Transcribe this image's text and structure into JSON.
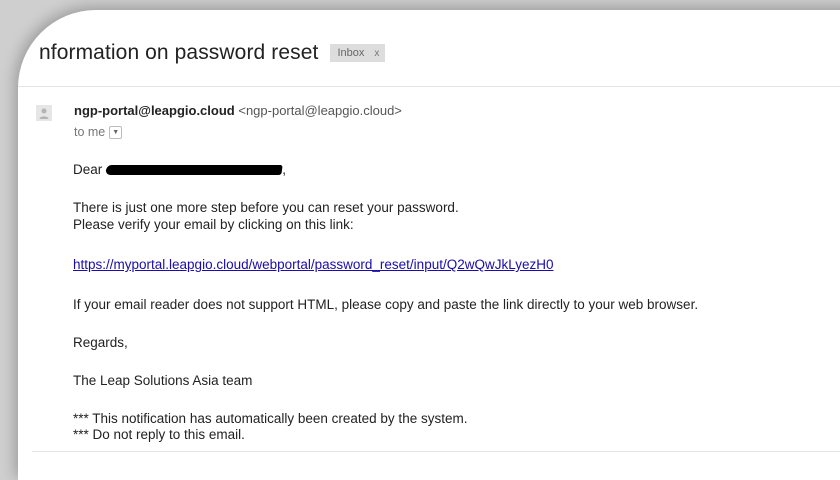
{
  "email": {
    "subject": "nformation on password reset",
    "label": "Inbox",
    "label_close": "x",
    "sender_name": "ngp-portal@leapgio.cloud",
    "sender_email": "<ngp-portal@leapgio.cloud>",
    "to": "to me",
    "greeting_prefix": "Dear",
    "greeting_suffix": ",",
    "line1": "There is just one more step before you can reset your password.",
    "line2": "Please verify your email by clicking on this link:",
    "reset_link": "https://myportal.leapgio.cloud/webportal/password_reset/input/Q2wQwJkLyezH0",
    "html_note": "If your email reader does not support HTML, please copy and paste the link directly to your web browser.",
    "regards": "Regards,",
    "team": "The Leap Solutions Asia team",
    "notice1": "*** This notification has automatically been created by the system.",
    "notice2": "*** Do not reply to this email."
  },
  "icons": {
    "avatar": "person-icon",
    "dropdown": "chevron-down-icon"
  },
  "colors": {
    "link": "#1a0dab",
    "label_bg": "#dddddd"
  }
}
